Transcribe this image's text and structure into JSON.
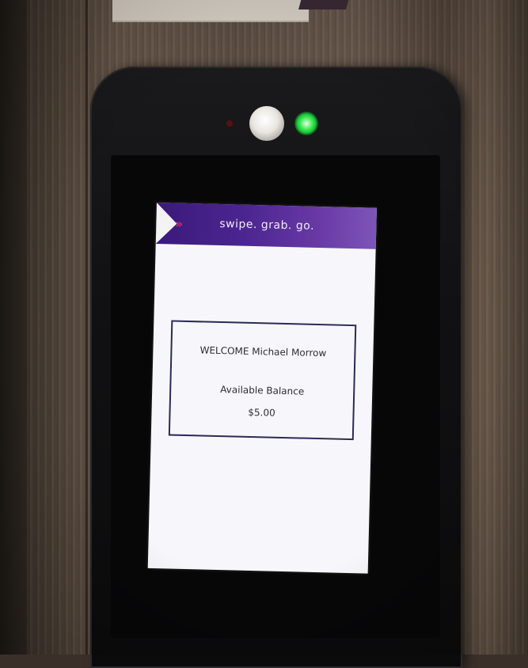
{
  "kiosk": {
    "header": {
      "slogan": "swipe. grab. go.",
      "arrows": "»"
    },
    "welcome": {
      "greeting": "WELCOME Michael Morrow",
      "balance_label": "Available Balance",
      "balance_amount": "$5.00"
    },
    "led": {
      "status_color": "#13c933"
    },
    "brand": {
      "header_color": "#4b2590",
      "accent_color": "#e0285a"
    }
  }
}
